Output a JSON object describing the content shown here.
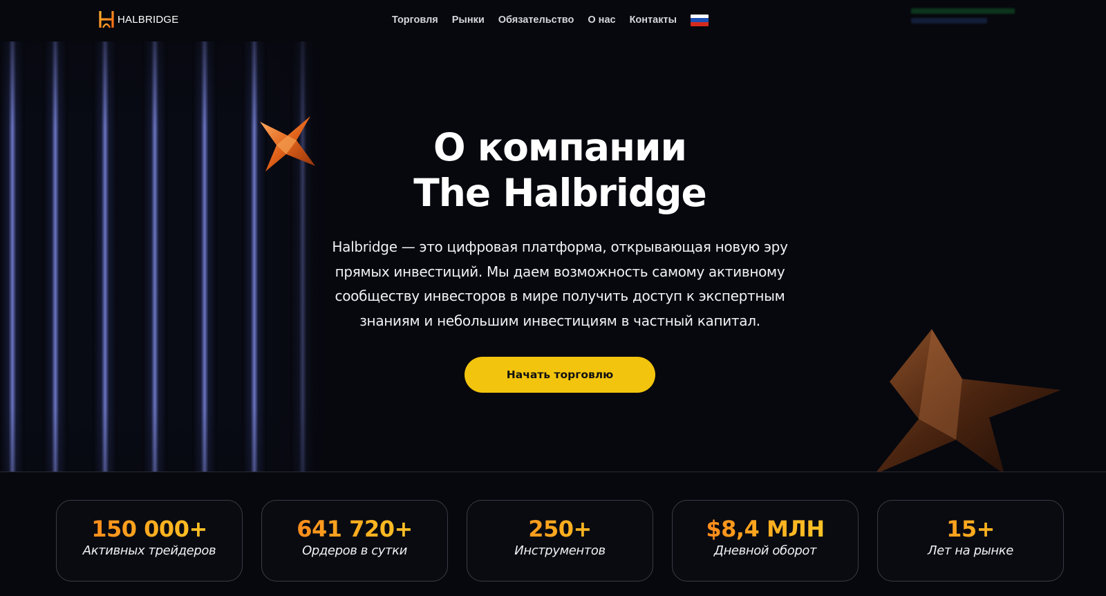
{
  "header": {
    "brand": "HALBRIDGE",
    "nav": [
      "Торговля",
      "Рынки",
      "Обязательство",
      "О нас",
      "Контакты"
    ],
    "language_flag_icon": "russia-flag-icon",
    "colors": {
      "flag": [
        "#ffffff",
        "#1c4fb3",
        "#d52b1e"
      ]
    }
  },
  "hero": {
    "title_line1": "О компании",
    "title_line2": "The Halbridge",
    "description": "Halbridge — это цифровая платформа, открывающая новую эру прямых инвестиций. Мы даем возможность самому активному сообществу инвесторов в мире получить доступ к экспертным знаниям и небольшим инвестициям в частный капитал.",
    "cta_label": "Начать торговлю"
  },
  "stats": [
    {
      "value": "150 000+",
      "label": "Активных трейдеров"
    },
    {
      "value": "641 720+",
      "label": "Ордеров в сутки"
    },
    {
      "value": "250+",
      "label": "Инструментов"
    },
    {
      "value": "$8,4 МЛН",
      "label": "Дневной оборот"
    },
    {
      "value": "15+",
      "label": "Лет на рынке"
    }
  ],
  "colors": {
    "background": "#07080e",
    "accent_cta": "#f2c40e",
    "stat_gradient": [
      "#ff7a1a",
      "#ffd12b"
    ],
    "card_border": "#3a3c46"
  }
}
